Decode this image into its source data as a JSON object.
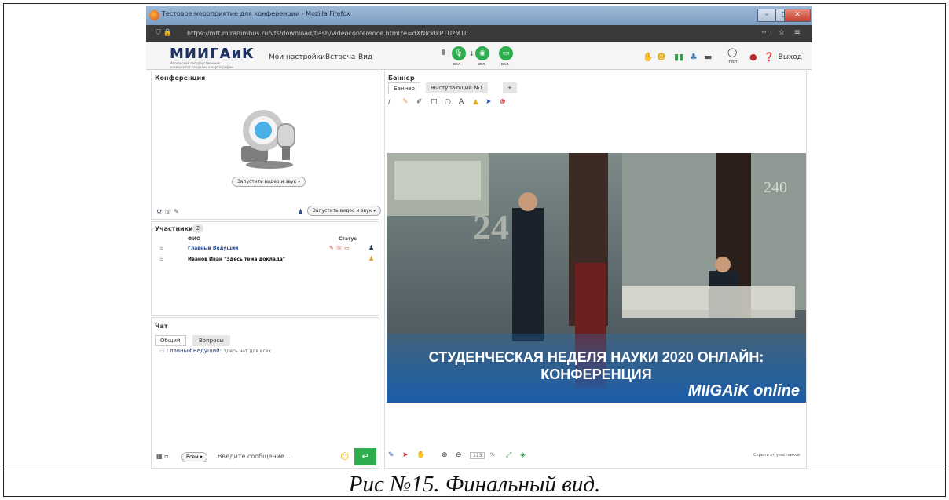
{
  "caption": "Рис №15. Финальный вид.",
  "window": {
    "title": "Тестовое мероприятие для конференции - Mozilla Firefox",
    "url": "https://mft.miranimbus.ru/vfs/download/flash/videoconference.html?e=dXNlckIkPTUzMTI..."
  },
  "app": {
    "logo": "МИИГАиК",
    "logo_sub": "Московский государственный университет геодезии и картографии",
    "nav": [
      "Мои настройки",
      "Встреча",
      "Вид"
    ],
    "media_labels": [
      "вкл.",
      "вкл.",
      "вкл."
    ],
    "exit": "Выход",
    "record_label": "тест"
  },
  "conference": {
    "title": "Конференция",
    "start_button": "Запустить видео и звук",
    "start_button2": "Запустить видео и звук"
  },
  "participants": {
    "title": "Участники",
    "count": "2",
    "col_name": "ФИО",
    "col_status": "Статус",
    "rows": [
      {
        "name": "Главный Ведущий",
        "color": "#2c4a8a"
      },
      {
        "name": "Иванов Иван \"Здесь тема доклада\"",
        "color": "#111111"
      }
    ]
  },
  "chat": {
    "title": "Чат",
    "tabs": [
      "Общий",
      "Вопросы"
    ],
    "author": "Главный Ведущий:",
    "message": "Здесь чат для всех",
    "recipient": "Всем",
    "placeholder": "Введите сообщение..."
  },
  "banner": {
    "title": "Баннер",
    "tabs": [
      "Баннер",
      "Выступающий №1",
      "+"
    ],
    "line1": "СТУДЕНЧЕСКАЯ НЕДЕЛЯ НАУКИ 2020 ОНЛАЙН:",
    "line2": "КОНФЕРЕНЦИЯ",
    "brand": "MIIGAiK online",
    "bg_number": "240",
    "hide_label": "Скрыть от участников",
    "zoom": "113"
  },
  "colors": {
    "accent_green": "#2eae4f",
    "brand_blue": "#1d3264",
    "banner_band": "#1f73c4"
  }
}
